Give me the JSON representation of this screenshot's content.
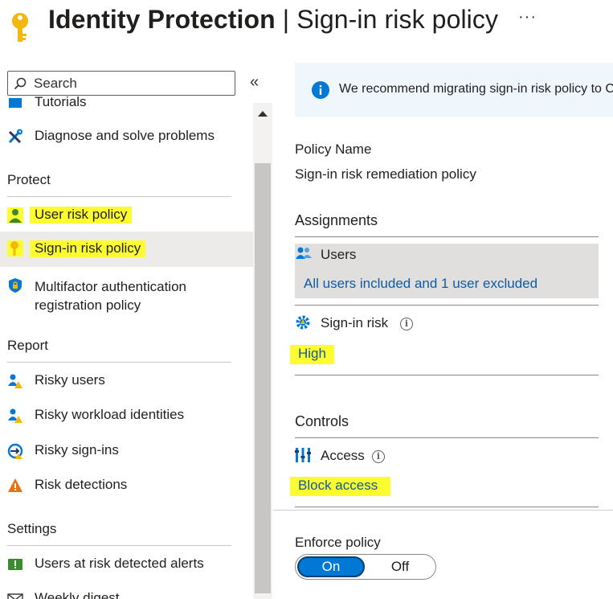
{
  "header": {
    "title_bold": "Identity Protection",
    "title_sep": " | ",
    "title_rest": "Sign-in risk policy",
    "more": "···"
  },
  "search": {
    "placeholder": "Search"
  },
  "nav": {
    "collapse": "«",
    "tutorials_label": "Tutorials",
    "diagnose_label": "Diagnose and solve problems",
    "protect_header": "Protect",
    "user_risk_label": "User risk policy",
    "signin_risk_label": "Sign-in risk policy",
    "mfa_label": "Multifactor authentication registration policy",
    "report_header": "Report",
    "risky_users_label": "Risky users",
    "risky_workload_label": "Risky workload identities",
    "risky_signins_label": "Risky sign-ins",
    "risk_detections_label": "Risk detections",
    "settings_header": "Settings",
    "alerts_label": "Users at risk detected alerts",
    "weekly_label": "Weekly digest"
  },
  "banner": {
    "text": "We recommend migrating sign-in risk policy to Conditional Access"
  },
  "policy": {
    "name_label": "Policy Name",
    "name_value": "Sign-in risk remediation policy",
    "assignments_title": "Assignments",
    "users_label": "Users",
    "users_value": "All users included and 1 user excluded",
    "signin_risk_label": "Sign-in risk",
    "signin_risk_value": "High",
    "controls_title": "Controls",
    "access_label": "Access",
    "access_value": "Block access",
    "enforce_label": "Enforce policy",
    "toggle_on": "On",
    "toggle_off": "Off"
  },
  "colors": {
    "accent": "#0078d4",
    "link": "#0e5ba4",
    "highlight": "#fcfc30",
    "selected_bg": "#edebe9"
  }
}
